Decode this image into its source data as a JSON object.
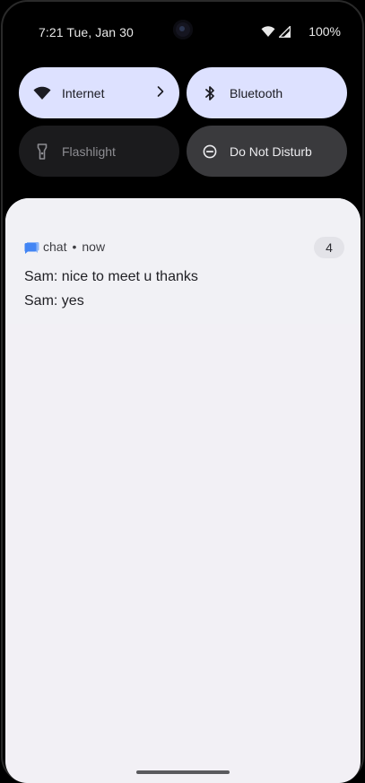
{
  "status_bar": {
    "time_date": "7:21 Tue, Jan 30",
    "battery": "100%",
    "icons": [
      "wifi-icon",
      "cellular-signal-icon"
    ]
  },
  "quick_settings": {
    "tiles": [
      {
        "label": "Internet",
        "icon": "wifi-icon",
        "state": "on",
        "has_chevron": true
      },
      {
        "label": "Bluetooth",
        "icon": "bluetooth-icon",
        "state": "on"
      },
      {
        "label": "Flashlight",
        "icon": "flashlight-icon",
        "state": "unavailable"
      },
      {
        "label": "Do Not Disturb",
        "icon": "dnd-icon",
        "state": "off"
      }
    ],
    "colors": {
      "active": "#dde1ff",
      "inactive": "#3a3a3d",
      "unavailable": "#1b1b1d"
    }
  },
  "notification": {
    "app_name": "chat",
    "separator": "•",
    "time": "now",
    "count": "4",
    "icon": "chat-app-icon",
    "messages": [
      {
        "text": "Sam: nice to meet u thanks"
      },
      {
        "text": "Sam: yes"
      }
    ]
  }
}
